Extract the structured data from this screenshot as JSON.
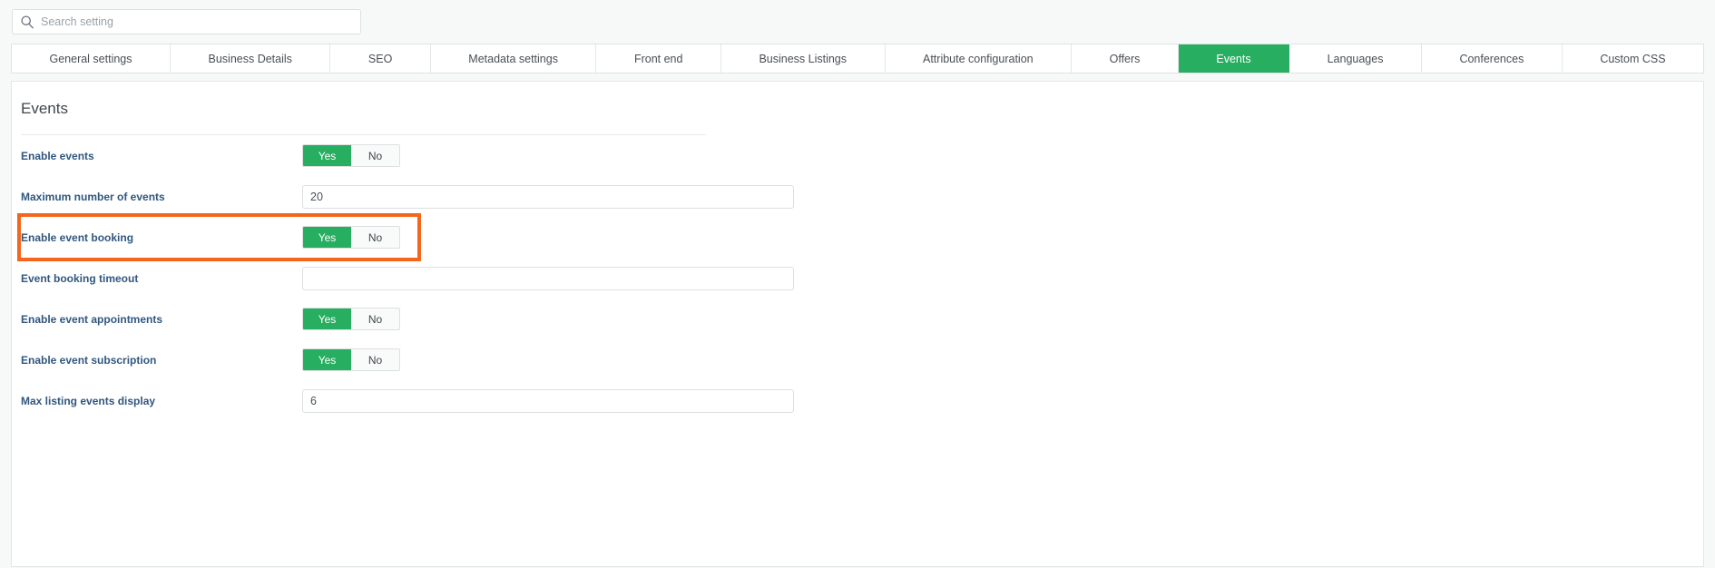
{
  "search": {
    "placeholder": "Search setting",
    "value": "",
    "icon": "search-icon"
  },
  "tabs": [
    {
      "label": "General settings",
      "active": false
    },
    {
      "label": "Business Details",
      "active": false
    },
    {
      "label": "SEO",
      "active": false
    },
    {
      "label": "Metadata settings",
      "active": false
    },
    {
      "label": "Front end",
      "active": false
    },
    {
      "label": "Business Listings",
      "active": false
    },
    {
      "label": "Attribute configuration",
      "active": false
    },
    {
      "label": "Offers",
      "active": false
    },
    {
      "label": "Events",
      "active": true
    },
    {
      "label": "Languages",
      "active": false
    },
    {
      "label": "Conferences",
      "active": false
    },
    {
      "label": "Custom CSS",
      "active": false
    }
  ],
  "panel": {
    "title": "Events",
    "rows": [
      {
        "label": "Enable events",
        "type": "toggle",
        "yes_label": "Yes",
        "no_label": "No",
        "selected": "Yes",
        "highlighted": false
      },
      {
        "label": "Maximum number of events",
        "type": "text",
        "value": "20",
        "placeholder": "",
        "highlighted": false
      },
      {
        "label": "Enable event booking",
        "type": "toggle",
        "yes_label": "Yes",
        "no_label": "No",
        "selected": "Yes",
        "highlighted": true
      },
      {
        "label": "Event booking timeout",
        "type": "text",
        "value": "",
        "placeholder": "",
        "highlighted": false
      },
      {
        "label": "Enable event appointments",
        "type": "toggle",
        "yes_label": "Yes",
        "no_label": "No",
        "selected": "Yes",
        "highlighted": false
      },
      {
        "label": "Enable event subscription",
        "type": "toggle",
        "yes_label": "Yes",
        "no_label": "No",
        "selected": "Yes",
        "highlighted": false
      },
      {
        "label": "Max listing events display",
        "type": "text",
        "value": "6",
        "placeholder": "",
        "highlighted": false
      }
    ]
  },
  "colors": {
    "accent_green": "#27ae60",
    "highlight_orange": "#f4661b",
    "label_blue": "#31577f",
    "page_background": "#f7f9f9"
  }
}
